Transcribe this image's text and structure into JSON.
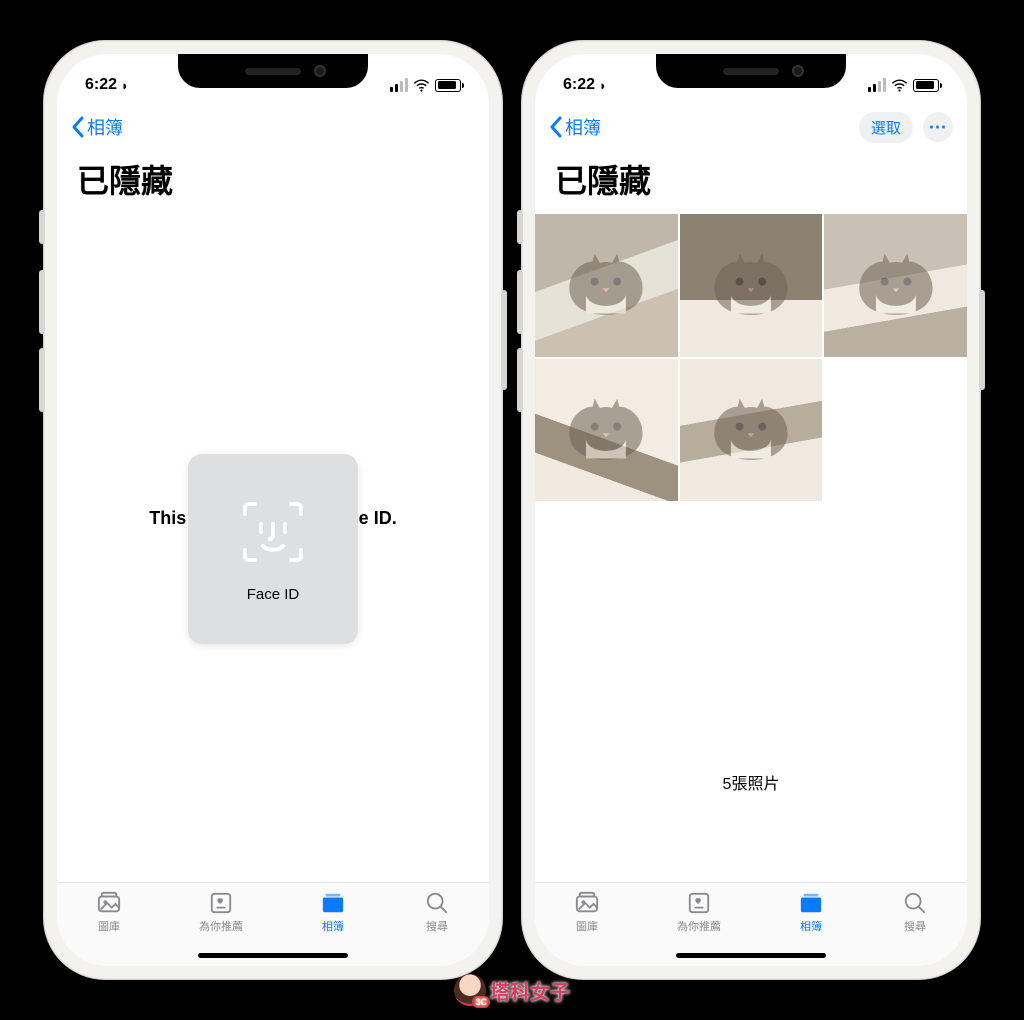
{
  "status": {
    "time": "6:22",
    "moon_icon": "◗"
  },
  "nav": {
    "back_label": "相簿",
    "select_label": "選取"
  },
  "page": {
    "title": "已隱藏",
    "locked_message": "This Album requires Face ID.",
    "faceid_label": "Face ID",
    "photo_count": "5張照片"
  },
  "tabs": {
    "library": "圖庫",
    "for_you": "為你推薦",
    "albums": "相簿",
    "search": "搜尋"
  },
  "watermark": "塔科女子",
  "colors": {
    "ios_blue": "#0a7aff",
    "face_card": "#dedfe1"
  }
}
